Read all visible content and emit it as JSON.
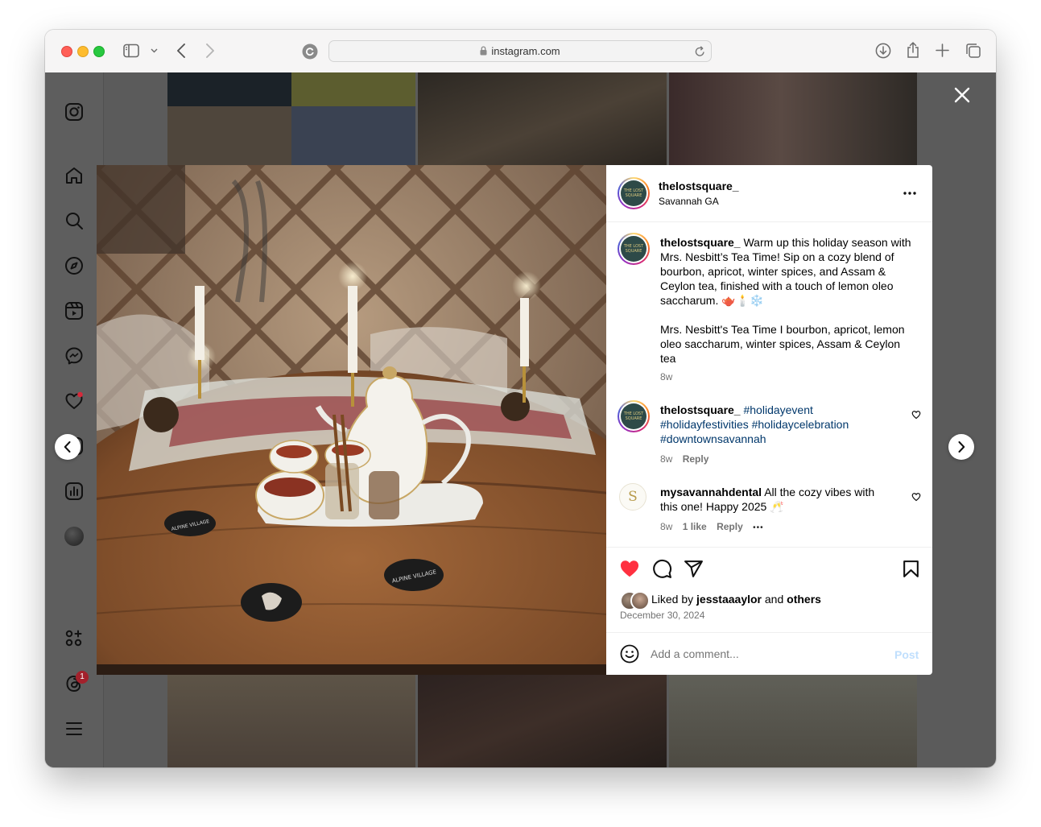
{
  "browser": {
    "url": "instagram.com"
  },
  "post": {
    "username": "thelostsquare_",
    "location": "Savannah GA",
    "caption_username": "thelostsquare_",
    "caption_text": "Warm up this holiday season with Mrs. Nesbitt’s Tea Time! Sip on a cozy blend of bourbon, apricot, winter spices, and Assam & Ceylon tea, finished with a touch of lemon oleo saccharum. 🫖🕯️❄️",
    "caption_text_2": "Mrs. Nesbitt's Tea Time I bourbon, apricot, lemon oleo saccharum, winter spices, Assam & Ceylon tea",
    "caption_time": "8w",
    "avatar_text": "THE LOST SQUARE",
    "image_coaster_1": "ALPINE VILLAGE",
    "image_coaster_2": "ALPINE VILLAGE"
  },
  "comments": [
    {
      "username": "thelostsquare_",
      "text": "#holidayevent #holidayfestivities #holidaycelebration #downtownsavannah",
      "time": "8w",
      "reply": "Reply"
    },
    {
      "username": "mysavannahdental",
      "text": "All the cozy vibes with this one! Happy 2025 🥂",
      "time": "8w",
      "likes": "1 like",
      "reply": "Reply",
      "more": "•••",
      "avatar_text": "S"
    }
  ],
  "actions": {
    "liked_by_prefix": "Liked by",
    "liked_by_user": "jesstaaaylor",
    "liked_by_and": "and",
    "liked_by_others": "others",
    "date": "December 30, 2024",
    "comment_placeholder": "Add a comment...",
    "post_label": "Post"
  },
  "sidebar": {
    "notification_count": "1"
  },
  "colors": {
    "like_red": "#ff3040",
    "hashtag_blue": "#00376b",
    "post_disabled": "#c0dffd",
    "overlay": "#5b5b5b"
  },
  "icons": [
    "instagram-icon",
    "home-icon",
    "search-icon",
    "explore-icon",
    "reels-icon",
    "messenger-icon",
    "heart-icon",
    "create-icon",
    "dashboard-icon",
    "profile-avatar",
    "meta-apps-icon",
    "threads-icon",
    "menu-icon",
    "close-icon",
    "more-icon",
    "comment-icon",
    "share-icon",
    "save-icon",
    "emoji-icon",
    "chevron-left-icon",
    "chevron-right-icon"
  ]
}
